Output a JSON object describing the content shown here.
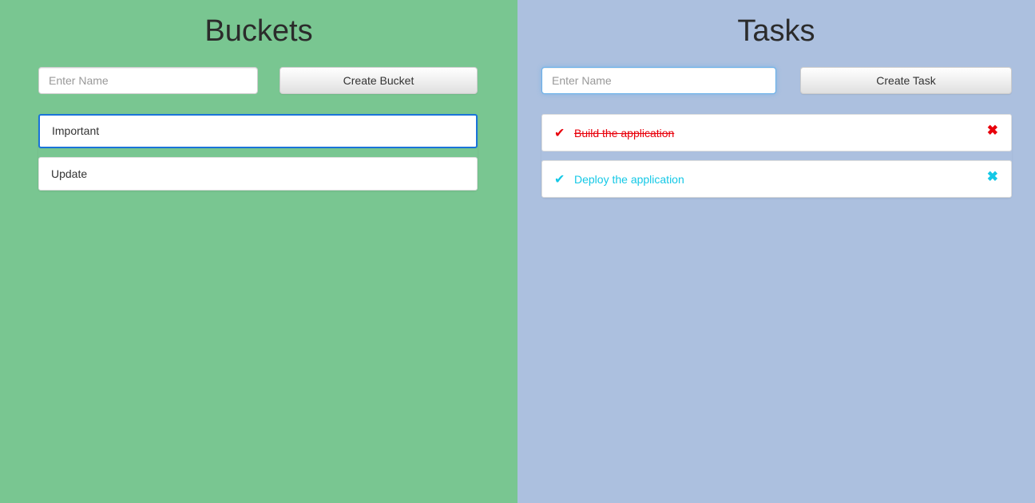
{
  "buckets": {
    "title": "Buckets",
    "name_input": {
      "placeholder": "Enter Name",
      "value": ""
    },
    "create_button": "Create Bucket",
    "items": [
      {
        "label": "Important",
        "selected": true
      },
      {
        "label": "Update",
        "selected": false
      }
    ]
  },
  "tasks": {
    "title": "Tasks",
    "name_input": {
      "placeholder": "Enter Name",
      "value": ""
    },
    "create_button": "Create Task",
    "items": [
      {
        "label": "Build the application",
        "completed": true,
        "check_icon": "checkmark-icon",
        "remove_icon": "close-icon"
      },
      {
        "label": "Deploy the application",
        "completed": false,
        "check_icon": "checkmark-icon",
        "remove_icon": "close-icon"
      }
    ]
  },
  "colors": {
    "buckets_background": "#79c691",
    "tasks_background": "#acc0df",
    "completed_task": "#e8000b",
    "open_task": "#14c8e6",
    "selected_bucket_border": "#1a73d9"
  }
}
